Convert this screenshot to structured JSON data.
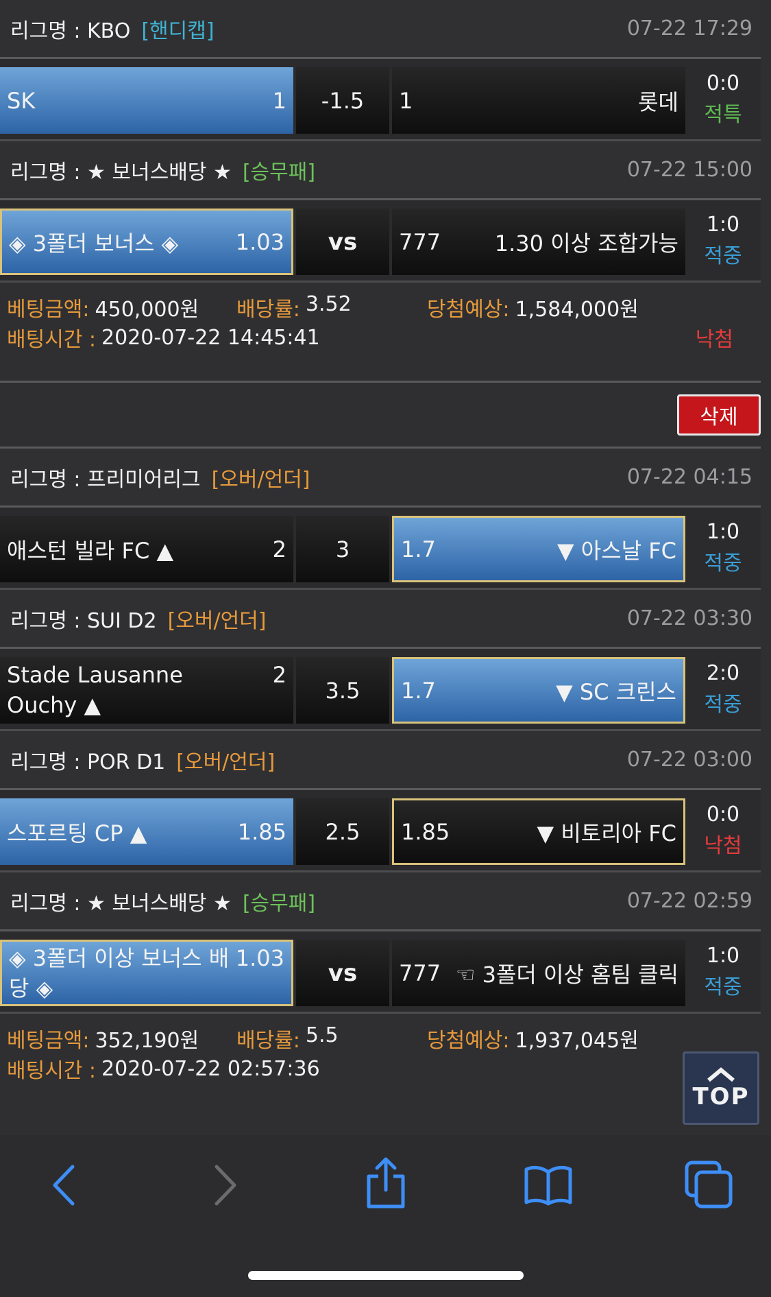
{
  "sections": [
    {
      "league_label": "리그명 : KBO",
      "type_label": "[핸디캡]",
      "type_color": "#3fb3d3",
      "time": "07-22 17:29",
      "home_name": "SK",
      "home_odds": "1",
      "mid": "-1.5",
      "away_odds": "1",
      "away_name": "롯데",
      "score": "0:0",
      "result": "적특"
    },
    {
      "league_label": "리그명 : ★ 보너스배당 ★",
      "type_label": "[승무패]",
      "type_color": "#6cc15a",
      "time": "07-22 15:00",
      "home_name": "◈ 3폴더 보너스 ◈",
      "home_odds": "1.03",
      "mid": "vs",
      "away_odds": "777",
      "away_name": "1.30 이상 조합가능",
      "score": "1:0",
      "result": "적중"
    },
    {
      "league_label": "리그명 : 프리미어리그",
      "type_label": "[오버/언더]",
      "type_color": "#e79a3c",
      "time": "07-22 04:15",
      "home_name": "애스턴 빌라 FC ▲",
      "home_odds": "2",
      "mid": "3",
      "away_odds": "1.7",
      "away_name": "▼ 아스날 FC",
      "score": "1:0",
      "result": "적중"
    },
    {
      "league_label": "리그명 : SUI D2",
      "type_label": "[오버/언더]",
      "type_color": "#e79a3c",
      "time": "07-22 03:30",
      "home_name_line1": "Stade Lausanne",
      "home_name_line2": "Ouchy ▲",
      "home_odds": "2",
      "mid": "3.5",
      "away_odds": "1.7",
      "away_name": "▼ SC 크린스",
      "score": "2:0",
      "result": "적중"
    },
    {
      "league_label": "리그명 : POR D1",
      "type_label": "[오버/언더]",
      "type_color": "#e79a3c",
      "time": "07-22 03:00",
      "home_name": "스포르팅 CP ▲",
      "home_odds": "1.85",
      "mid": "2.5",
      "away_odds": "1.85",
      "away_name": "▼ 비토리아 FC",
      "score": "0:0",
      "result": "낙첨"
    },
    {
      "league_label": "리그명 : ★ 보너스배당 ★",
      "type_label": "[승무패]",
      "type_color": "#6cc15a",
      "time": "07-22 02:59",
      "home_name_line1": "◈ 3폴더 이상 보너스 배",
      "home_name_line2": "당 ◈",
      "home_odds": "1.03",
      "mid": "vs",
      "away_odds": "777",
      "away_name": "☜ 3폴더 이상 홈팀 클릭",
      "score": "1:0",
      "result": "적중"
    }
  ],
  "bet1": {
    "amount_label": "베팅금액:",
    "amount": "450,000원",
    "rate_label": "배당률:",
    "rate": "3.52",
    "expected_label": "당첨예상:",
    "expected": "1,584,000원",
    "time_label": "배팅시간 :",
    "time": "2020-07-22 14:45:41",
    "status": "낙첨"
  },
  "delete_label": "삭제",
  "bet2": {
    "amount_label": "베팅금액:",
    "amount": "352,190원",
    "rate_label": "배당률:",
    "rate": "5.5",
    "expected_label": "당첨예상:",
    "expected": "1,937,045원",
    "time_label": "배팅시간 :",
    "time": "2020-07-22 02:57:36"
  },
  "top_label": "TOP",
  "toolbar": {
    "icons": [
      "back-icon",
      "forward-icon",
      "share-icon",
      "bookmarks-icon",
      "tabs-icon"
    ]
  }
}
